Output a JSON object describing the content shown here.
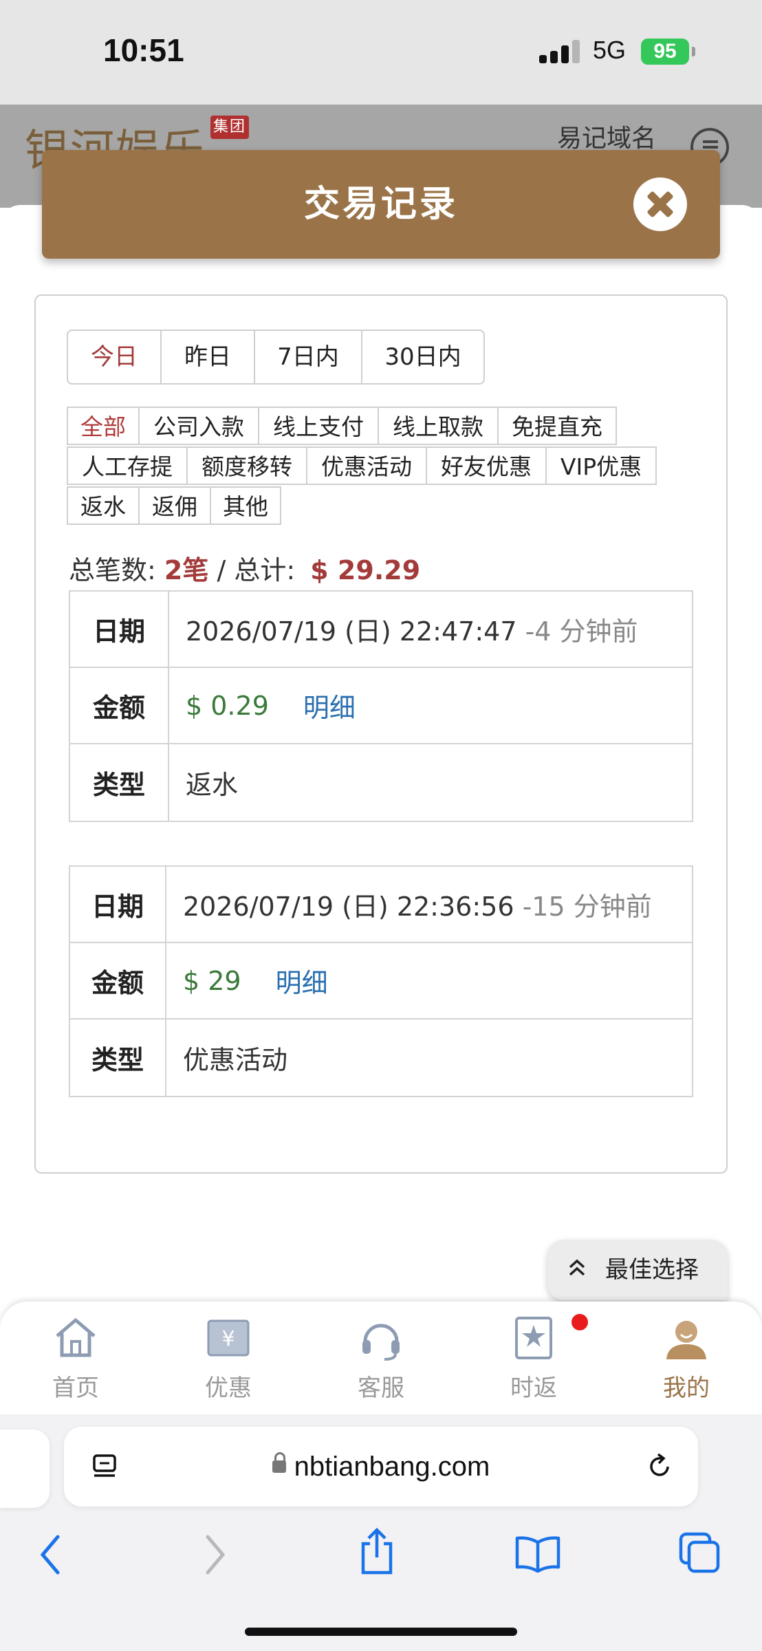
{
  "status_bar": {
    "time": "10:51",
    "network": "5G",
    "battery": "95"
  },
  "site": {
    "logo": "银河娱乐",
    "logo_badge": "集团",
    "top_link": "易记域名"
  },
  "modal": {
    "title": "交易记录"
  },
  "periods": [
    {
      "label": "今日",
      "active": true
    },
    {
      "label": "昨日",
      "active": false
    },
    {
      "label": "7日内",
      "active": false
    },
    {
      "label": "30日内",
      "active": false
    }
  ],
  "filters": {
    "row1": [
      "全部",
      "公司入款",
      "线上支付",
      "线上取款",
      "免提直充"
    ],
    "row2": [
      "人工存提",
      "额度移转",
      "优惠活动",
      "好友优惠",
      "VIP优惠"
    ],
    "row3": [
      "返水",
      "返佣",
      "其他"
    ],
    "active": "全部"
  },
  "summary": {
    "count_label": "总笔数:",
    "count_value": "2笔",
    "separator": "/",
    "total_label": "总计:",
    "total_value": "$ 29.29"
  },
  "records": [
    {
      "date_label": "日期",
      "date": "2026/07/19 (日) 22:47:47",
      "ago": "-4 分钟前",
      "amount_label": "金额",
      "amount": "$ 0.29",
      "detail": "明细",
      "type_label": "类型",
      "type": "返水"
    },
    {
      "date_label": "日期",
      "date": "2026/07/19 (日) 22:36:56",
      "ago": "-15 分钟前",
      "amount_label": "金额",
      "amount": "$ 29",
      "detail": "明细",
      "type_label": "类型",
      "type": "优惠活动"
    }
  ],
  "best_choice": {
    "label": "最佳选择"
  },
  "bottom_nav": [
    {
      "label": "首页",
      "icon": "home-icon",
      "active": false
    },
    {
      "label": "优惠",
      "icon": "coupon-icon",
      "active": false
    },
    {
      "label": "客服",
      "icon": "headset-icon",
      "active": false
    },
    {
      "label": "时返",
      "icon": "star-badge-icon",
      "active": false
    },
    {
      "label": "我的",
      "icon": "user-avatar-icon",
      "active": true
    }
  ],
  "browser": {
    "url": "nbtianbang.com"
  },
  "colors": {
    "brand": "#9a7448",
    "active_red": "#a33b3b",
    "amount_green": "#3a7a3a",
    "link_blue": "#2a6fb0"
  }
}
